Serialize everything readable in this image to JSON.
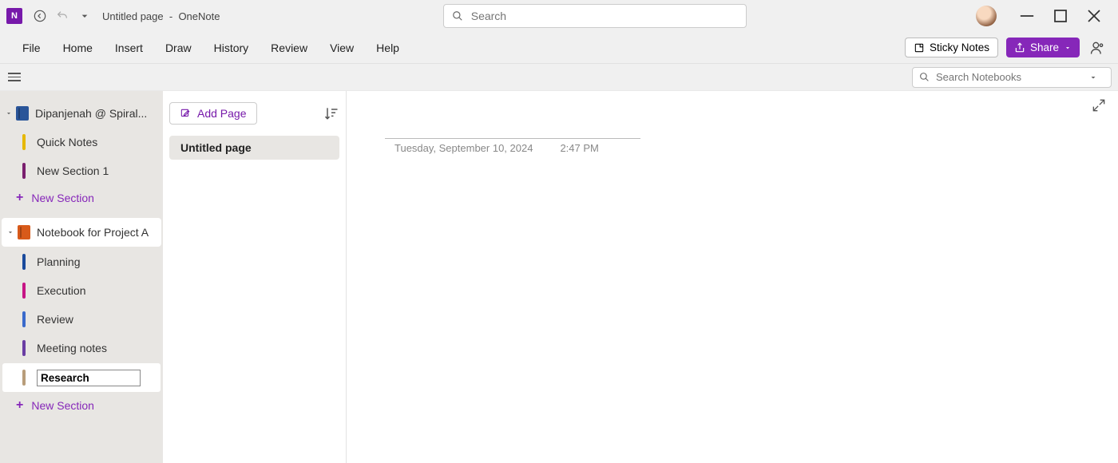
{
  "titlebar": {
    "page_title": "Untitled page",
    "separator": "-",
    "app_name": "OneNote",
    "search_placeholder": "Search"
  },
  "menu": {
    "items": [
      "File",
      "Home",
      "Insert",
      "Draw",
      "History",
      "Review",
      "View",
      "Help"
    ],
    "sticky_notes": "Sticky Notes",
    "share": "Share"
  },
  "secbar": {
    "search_placeholder": "Search Notebooks"
  },
  "nav": {
    "notebooks": [
      {
        "name": "Dipanjenah @ Spiral...",
        "color": "nb-blue",
        "selected": false,
        "sections": [
          {
            "label": "Quick Notes",
            "color": "c-yellow"
          },
          {
            "label": "New Section 1",
            "color": "c-teal"
          }
        ],
        "new_section_label": "New Section"
      },
      {
        "name": "Notebook for Project A",
        "color": "nb-orange",
        "selected": true,
        "sections": [
          {
            "label": "Planning",
            "color": "c-blue"
          },
          {
            "label": "Execution",
            "color": "c-pink"
          },
          {
            "label": "Review",
            "color": "c-blue2"
          },
          {
            "label": "Meeting notes",
            "color": "c-purple"
          }
        ],
        "editing_section": {
          "value": "Research",
          "color": "c-tan"
        },
        "new_section_label": "New Section"
      }
    ]
  },
  "pagelist": {
    "add_page_label": "Add Page",
    "pages": [
      {
        "title": "Untitled page",
        "active": true
      }
    ]
  },
  "canvas": {
    "date": "Tuesday, September 10, 2024",
    "time": "2:47 PM"
  }
}
